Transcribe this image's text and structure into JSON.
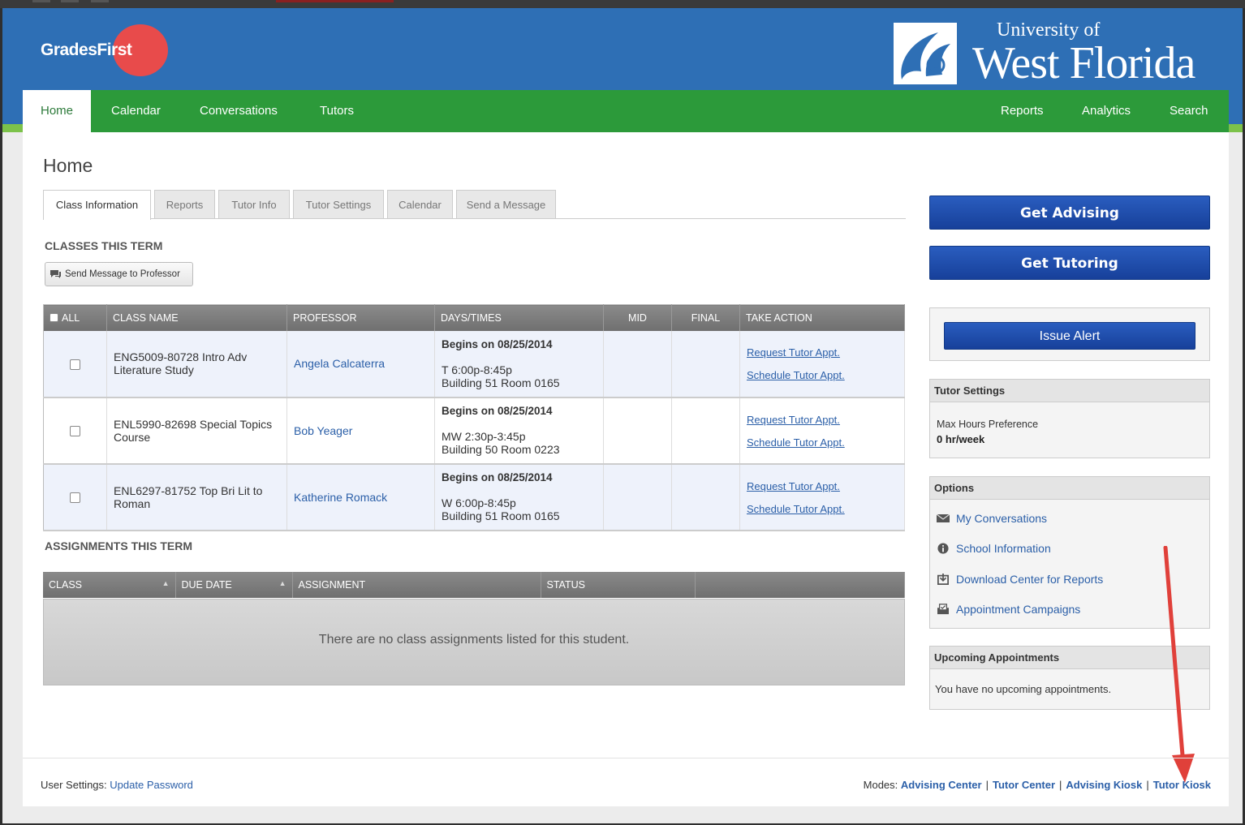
{
  "header": {
    "logo_part1": "Grades",
    "logo_part2": "First",
    "school_line1": "University of",
    "school_line2": "West Florida"
  },
  "nav": {
    "left": [
      "Home",
      "Calendar",
      "Conversations",
      "Tutors"
    ],
    "right": [
      "Reports",
      "Analytics",
      "Search"
    ],
    "active": "Home"
  },
  "page": {
    "title": "Home",
    "tabs": [
      "Class Information",
      "Reports",
      "Tutor Info",
      "Tutor Settings",
      "Calendar",
      "Send a Message"
    ],
    "active_tab": "Class Information"
  },
  "classes": {
    "section_title": "CLASSES THIS TERM",
    "send_button": "Send Message to Professor",
    "columns": [
      "ALL",
      "CLASS NAME",
      "PROFESSOR",
      "DAYS/TIMES",
      "MID",
      "FINAL",
      "TAKE ACTION"
    ],
    "rows": [
      {
        "class_name": "ENG5009-80728 Intro Adv Literature Study",
        "professor": "Angela Calcaterra",
        "begins": "Begins on 08/25/2014",
        "time": "T 6:00p-8:45p",
        "location": "Building 51 Room 0165",
        "mid": "",
        "final": "",
        "action1": "Request Tutor Appt.",
        "action2": "Schedule Tutor Appt."
      },
      {
        "class_name": "ENL5990-82698 Special Topics Course",
        "professor": "Bob Yeager",
        "begins": "Begins on 08/25/2014",
        "time": "MW 2:30p-3:45p",
        "location": "Building 50 Room 0223",
        "mid": "",
        "final": "",
        "action1": "Request Tutor Appt.",
        "action2": "Schedule Tutor Appt."
      },
      {
        "class_name": "ENL6297-81752 Top Bri Lit to Roman",
        "professor": "Katherine Romack",
        "begins": "Begins on 08/25/2014",
        "time": "W 6:00p-8:45p",
        "location": "Building 51 Room 0165",
        "mid": "",
        "final": "",
        "action1": "Request Tutor Appt.",
        "action2": "Schedule Tutor Appt."
      }
    ]
  },
  "assignments": {
    "section_title": "ASSIGNMENTS THIS TERM",
    "columns": [
      "CLASS",
      "DUE DATE",
      "ASSIGNMENT",
      "STATUS",
      ""
    ],
    "empty_message": "There are no class assignments listed for this student."
  },
  "sidebar": {
    "get_advising": "Get Advising",
    "get_tutoring": "Get Tutoring",
    "issue_alert": "Issue Alert",
    "tutor_settings": {
      "title": "Tutor Settings",
      "label": "Max Hours Preference",
      "value": "0 hr/week"
    },
    "options": {
      "title": "Options",
      "items": [
        {
          "label": "My Conversations",
          "icon": "envelope-icon"
        },
        {
          "label": "School Information",
          "icon": "info-icon"
        },
        {
          "label": "Download Center for Reports",
          "icon": "download-icon"
        },
        {
          "label": "Appointment Campaigns",
          "icon": "campaign-icon"
        }
      ]
    },
    "upcoming": {
      "title": "Upcoming Appointments",
      "message": "You have no upcoming appointments."
    }
  },
  "footer": {
    "user_settings_label": "User Settings:",
    "update_password": "Update Password",
    "modes_label": "Modes:",
    "modes": [
      "Advising Center",
      "Tutor Center",
      "Advising Kiosk",
      "Tutor Kiosk"
    ]
  },
  "colors": {
    "header_blue": "#2e6fb5",
    "nav_green": "#2c9a3a",
    "button_blue": "#1e4dab",
    "annotation_red": "#e0403a"
  }
}
